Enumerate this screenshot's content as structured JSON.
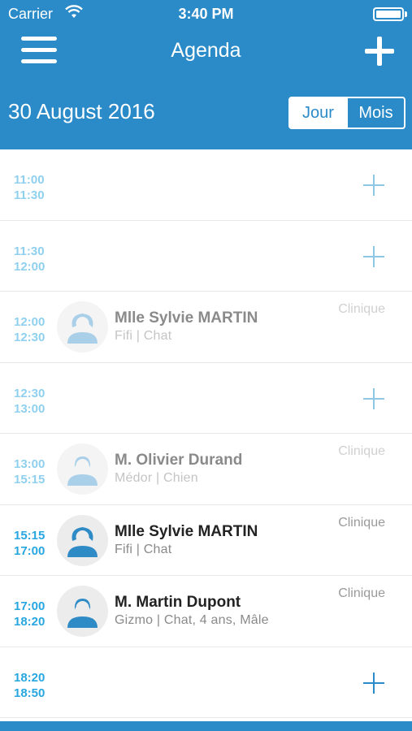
{
  "status_bar": {
    "carrier": "Carrier",
    "time": "3:40 PM"
  },
  "header": {
    "title": "Agenda",
    "date": "30 August 2016",
    "view_toggle": {
      "options": [
        "Jour",
        "Mois"
      ],
      "selected": "Jour"
    }
  },
  "colors": {
    "primary": "#2a8bc8",
    "time_light": "#8fd0ef",
    "time_active": "#27a6e0"
  },
  "slots": [
    {
      "start": "11:00",
      "end": "11:30",
      "empty": true
    },
    {
      "start": "11:30",
      "end": "12:00",
      "empty": true
    },
    {
      "start": "12:00",
      "end": "12:30",
      "name": "Mlle Sylvie MARTIN",
      "details": "Fifi | Chat",
      "place": "Clinique",
      "avatar": "female-avatar-icon"
    },
    {
      "start": "12:30",
      "end": "13:00",
      "empty": true
    },
    {
      "start": "13:00",
      "end": "15:15",
      "name": "M. Olivier Durand",
      "details": "Médor | Chien",
      "place": "Clinique",
      "avatar": "male-avatar-icon"
    },
    {
      "start": "15:15",
      "end": "17:00",
      "name": "Mlle Sylvie MARTIN",
      "details": "Fifi | Chat",
      "place": "Clinique",
      "avatar": "female-avatar-icon"
    },
    {
      "start": "17:00",
      "end": "18:20",
      "name": "M. Martin Dupont",
      "details": "Gizmo | Chat, 4 ans, Mâle",
      "place": "Clinique",
      "avatar": "male-avatar-icon"
    },
    {
      "start": "18:20",
      "end": "18:50",
      "empty": true
    }
  ]
}
